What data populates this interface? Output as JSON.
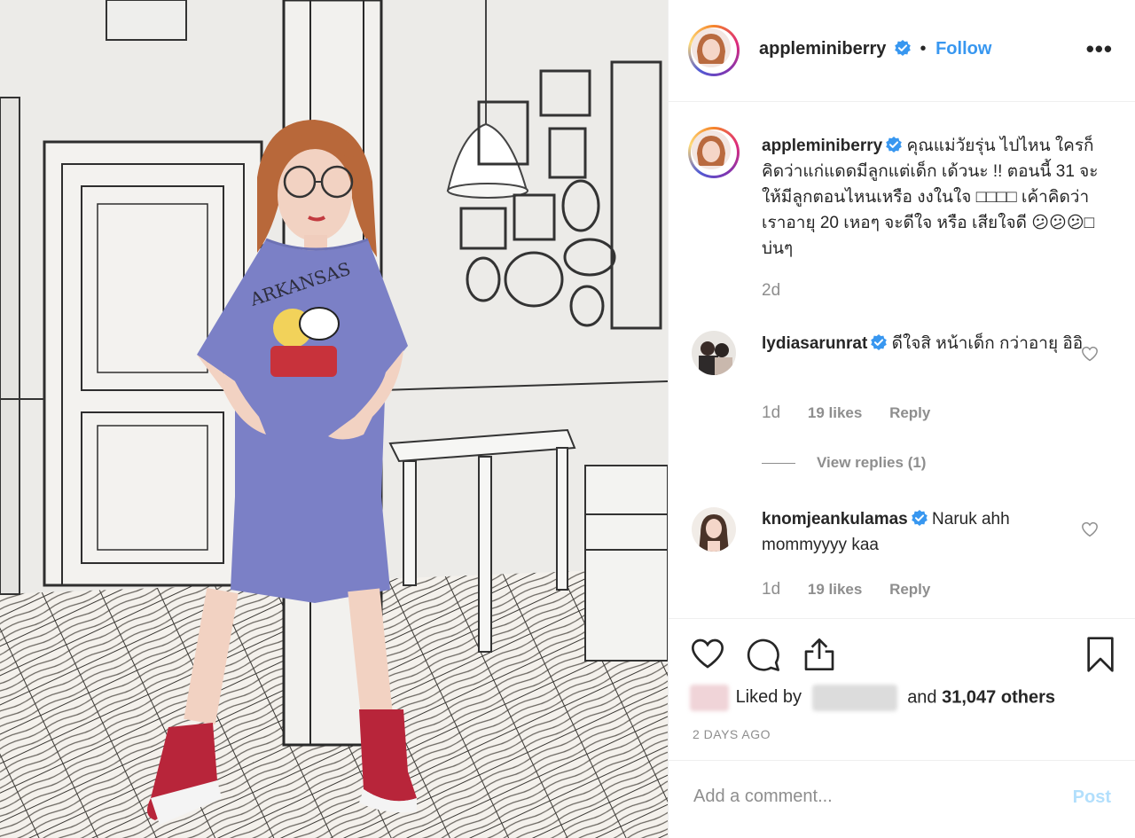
{
  "post": {
    "author": "appleminiberry",
    "follow_separator": "•",
    "follow_label": "Follow",
    "more_label": "•••"
  },
  "caption": {
    "username": "appleminiberry",
    "text": "คุณแม่วัยรุ่น ไปไหน ใครก็คิดว่าแก่แดดมีลูกแต่เด็ก เด้วนะ !! ตอนนี้ 31 จะให้มีลูกตอนไหนเหรือ งงในใจ □□□□ เค้าคิดว่าเราอายุ 20 เหอๆ จะดีใจ หรือ เสียใจดี 😕😕😕□ บ่นๆ",
    "time": "2d"
  },
  "comments": [
    {
      "username": "lydiasarunrat",
      "text": "ดีใจสิ หน้าเด็ก กว่าอายุ อิอิ",
      "time": "1d",
      "likes": "19 likes",
      "reply_label": "Reply"
    },
    {
      "username": "knomjeankulamas",
      "text": "Naruk ahh mommyyyy kaa",
      "time": "1d",
      "likes": "19 likes",
      "reply_label": "Reply"
    }
  ],
  "view_replies": "View replies (1)",
  "likes": {
    "liked_by_label": "Liked by",
    "and_label": "and",
    "others": "31,047 others"
  },
  "posted_ago": "2 DAYS AGO",
  "add_comment": {
    "placeholder": "Add a comment...",
    "post_label": "Post"
  },
  "icons": {
    "like": "heart-icon",
    "comment": "comment-bubble-icon",
    "share": "share-icon",
    "save": "bookmark-icon",
    "verified": "verified-badge-icon",
    "more": "more-options-icon"
  },
  "colors": {
    "link": "#3897f0",
    "verified": "#3897f0",
    "muted": "#8e8e8e",
    "text": "#262626",
    "post_disabled": "#b2dffc",
    "border": "#efefef"
  }
}
